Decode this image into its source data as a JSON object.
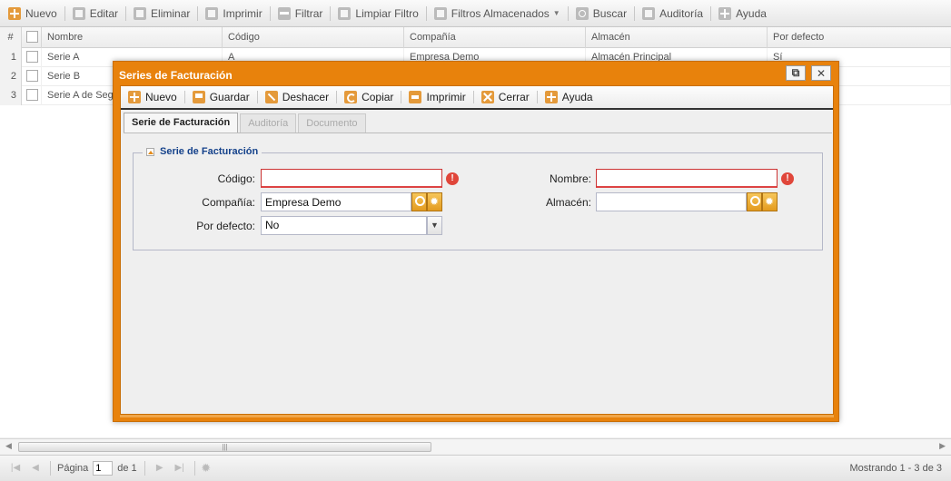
{
  "toolbar": {
    "items": [
      {
        "label": "Nuevo",
        "icon": "plus-icon"
      },
      {
        "label": "Editar",
        "icon": "edit-icon"
      },
      {
        "label": "Eliminar",
        "icon": "delete-icon"
      },
      {
        "label": "Imprimir",
        "icon": "print-icon"
      },
      {
        "label": "Filtrar",
        "icon": "filter-icon"
      },
      {
        "label": "Limpiar Filtro",
        "icon": "clear-filter-icon"
      },
      {
        "label": "Filtros Almacenados",
        "icon": "stored-filters-icon"
      },
      {
        "label": "Buscar",
        "icon": "search-icon"
      },
      {
        "label": "Auditoría",
        "icon": "audit-icon"
      },
      {
        "label": "Ayuda",
        "icon": "help-icon"
      }
    ]
  },
  "grid": {
    "columns": [
      "#",
      "Nombre",
      "Código",
      "Compañía",
      "Almacén",
      "Por defecto"
    ],
    "rows": [
      {
        "num": "1",
        "nombre": "Serie A",
        "codigo": "A",
        "compania": "Empresa Demo",
        "almacen": "Almacén Principal",
        "defecto": "Sí"
      },
      {
        "num": "2",
        "nombre": "Serie B",
        "codigo": "",
        "compania": "",
        "almacen": "",
        "defecto": ""
      },
      {
        "num": "3",
        "nombre": "Serie A de Seg",
        "codigo": "",
        "compania": "",
        "almacen": "",
        "defecto": ""
      }
    ]
  },
  "pager": {
    "page_label": "Página",
    "page_value": "1",
    "of_label": "de 1",
    "display": "Mostrando 1 - 3 de 3"
  },
  "modal": {
    "title": "Series de Facturación",
    "toolbar": [
      {
        "label": "Nuevo"
      },
      {
        "label": "Guardar"
      },
      {
        "label": "Deshacer"
      },
      {
        "label": "Copiar"
      },
      {
        "label": "Imprimir"
      },
      {
        "label": "Cerrar"
      },
      {
        "label": "Ayuda"
      }
    ],
    "tabs": [
      "Serie de Facturación",
      "Auditoría",
      "Documento"
    ],
    "fieldset_title": "Serie de Facturación",
    "fields": {
      "codigo_label": "Código:",
      "codigo_value": "",
      "nombre_label": "Nombre:",
      "nombre_value": "",
      "compania_label": "Compañía:",
      "compania_value": "Empresa Demo",
      "almacen_label": "Almacén:",
      "almacen_value": "",
      "defecto_label": "Por defecto:",
      "defecto_value": "No"
    }
  },
  "colors": {
    "accent": "#e8820c",
    "legend": "#15428b",
    "error": "#e0463a"
  }
}
